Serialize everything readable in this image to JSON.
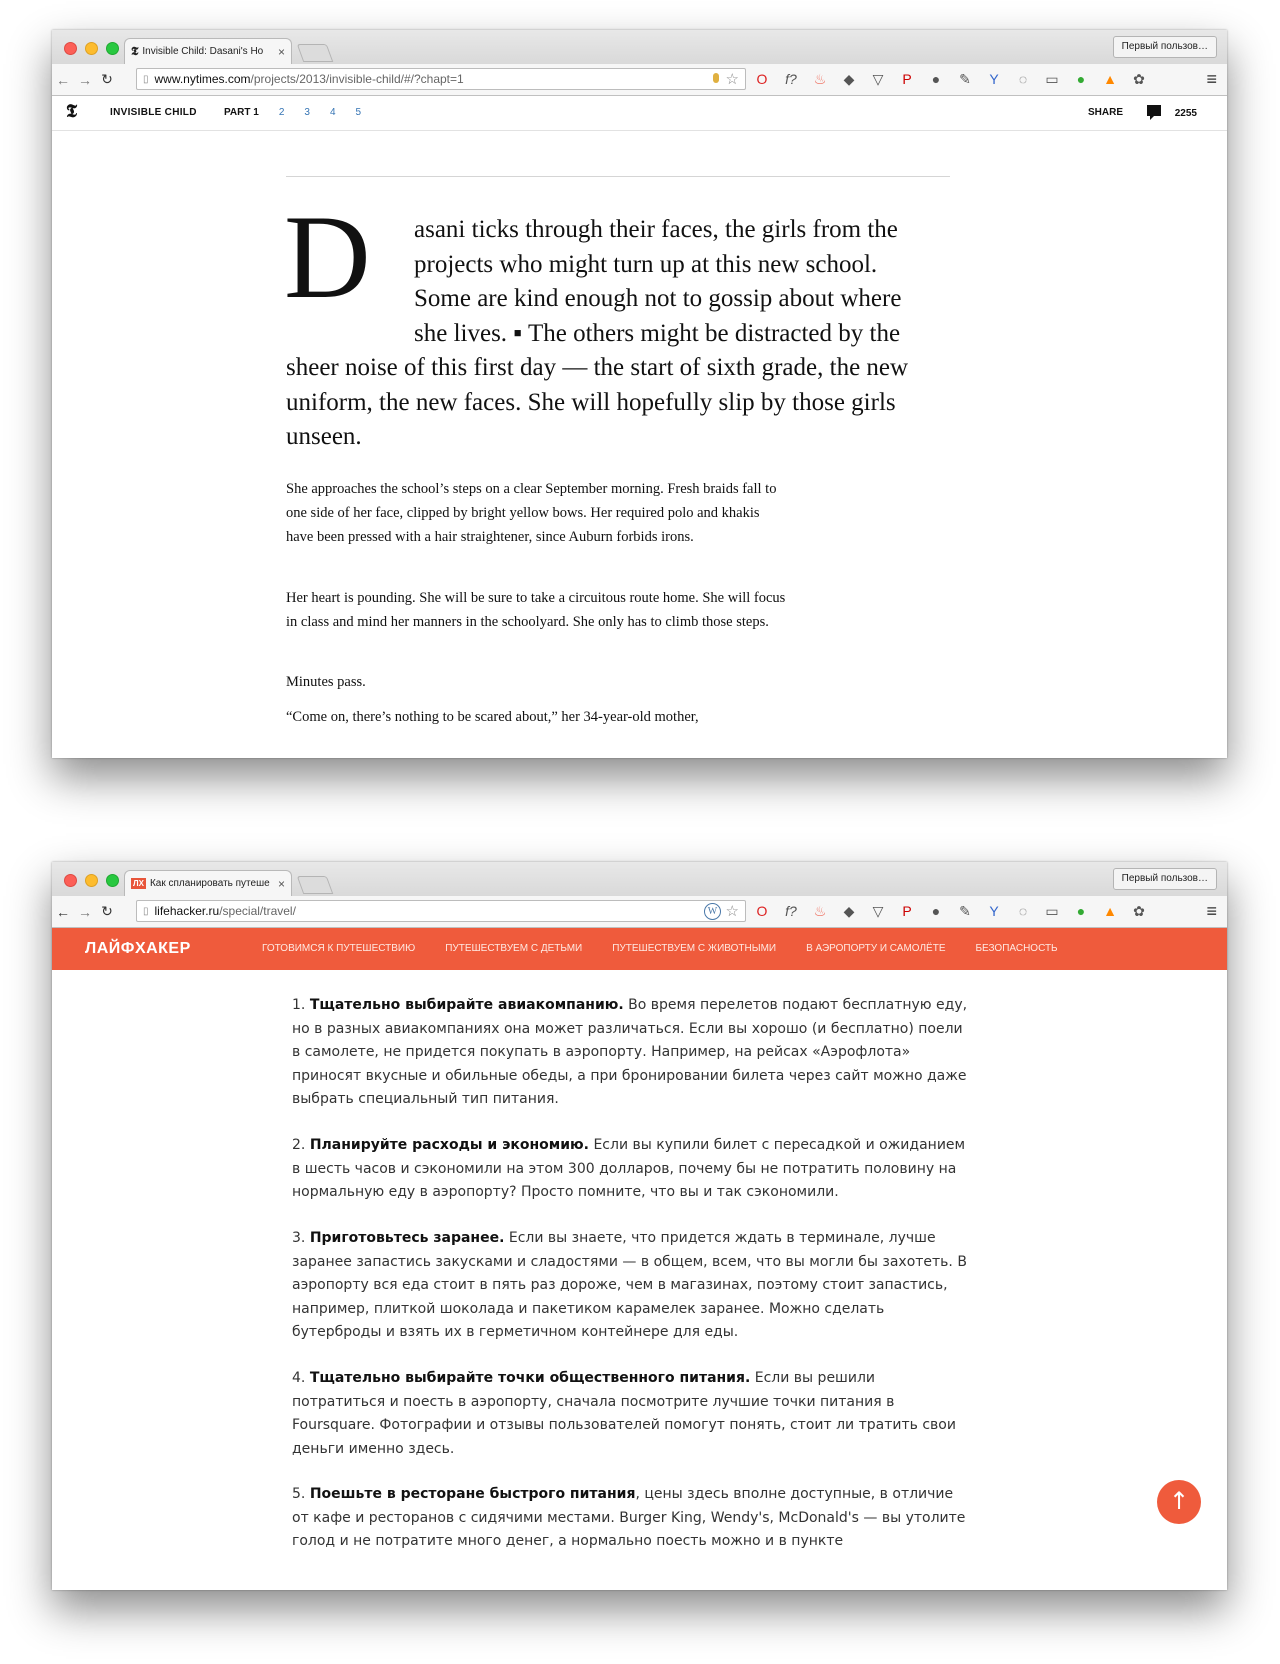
{
  "window1": {
    "tab": {
      "favicon": "𝕿",
      "title": "Invisible Child: Dasani's Ho",
      "close": "×"
    },
    "user_button": "Первый пользов…",
    "address": {
      "host": "www.nytimes.com",
      "path": "/projects/2013/invisible-child/#/?chapt=1"
    },
    "header": {
      "logo": "𝕿",
      "brand": "INVISIBLE CHILD",
      "part_label": "PART 1",
      "parts": [
        "2",
        "3",
        "4",
        "5"
      ],
      "share": "SHARE",
      "comments": "2255"
    },
    "article": {
      "dropcap": "D",
      "lede_lines": [
        "asani ticks through their faces, the girls from the",
        "projects who might turn up at this new school.",
        "Some are kind enough not to gossip about where",
        "she lives.  ▪  The others might be distracted by the"
      ],
      "lede_rest": "sheer noise of this first day — the start of sixth grade, the new uniform, the new faces. She will hopefully slip by those girls unseen.",
      "paragraphs": [
        "She approaches the school’s steps on a clear September morning. Fresh braids fall to one side of her face, clipped by bright yellow bows. Her required polo and khakis have been pressed with a hair straightener, since Auburn forbids irons.",
        "Her heart is pounding. She will be sure to take a circuitous route home. She will focus in class and mind her manners in the schoolyard. She only has to climb those steps.",
        "Minutes pass.",
        "“Come on, there’s nothing to be scared about,” her 34-year-old mother,"
      ]
    }
  },
  "window2": {
    "tab": {
      "favicon": "ЛХ",
      "title": "Как спланировать путеше",
      "close": "×"
    },
    "user_button": "Первый пользов…",
    "address": {
      "host": "lifehacker.ru",
      "path": "/special/travel/"
    },
    "header": {
      "logo": "ЛАЙФХАКЕР",
      "nav": [
        "ГОТОВИМСЯ К ПУТЕШЕСТВИЮ",
        "ПУТЕШЕСТВУЕМ С ДЕТЬМИ",
        "ПУТЕШЕСТВУЕМ С ЖИВОТНЫМИ",
        "В АЭРОПОРТУ И САМОЛЁТЕ",
        "БЕЗОПАСНОСТЬ"
      ]
    },
    "items": [
      {
        "num": "1. ",
        "bold": "Тщательно выбирайте авиакомпанию.",
        "text": " Во время перелетов подают бесплатную еду, но в разных авиакомпаниях она может различаться. Если вы хорошо (и бесплатно) поели в самолете, не придется покупать в аэропорту. Например, на рейсах «Аэрофлота» приносят вкусные и обильные обеды, а при бронировании билета через сайт можно даже выбрать специальный тип питания."
      },
      {
        "num": "2. ",
        "bold": "Планируйте расходы и экономию.",
        "text": " Если вы купили билет с пересадкой и ожиданием в шесть часов и сэкономили на этом 300 долларов, почему бы не потратить половину на нормальную еду в аэропорту? Просто помните, что вы и так сэкономили."
      },
      {
        "num": "3. ",
        "bold": "Приготовьтесь заранее.",
        "text": " Если вы знаете, что придется ждать в терминале, лучше заранее запастись закусками и сладостями — в общем, всем, что вы могли бы захотеть. В аэропорту вся еда стоит в пять раз дороже, чем в магазинах, поэтому стоит запастись, например, плиткой шоколада и пакетиком карамелек заранее. Можно сделать бутерброды и взять их в герметичном контейнере для еды."
      },
      {
        "num": "4. ",
        "bold": "Тщательно выбирайте точки общественного питания.",
        "text": " Если вы решили потратиться и поесть в аэропорту, сначала посмотрите лучшие точки питания в Foursquare. Фотографии и отзывы пользователей помогут понять, стоит ли тратить свои деньги именно здесь."
      },
      {
        "num": "5. ",
        "bold": "Поешьте в ресторане быстрого питания",
        "text": ", цены здесь вполне доступные, в отличие от кафе и ресторанов с сидячими местами. Burger King, Wendy's, McDonald's — вы утолите голод и не потратите много денег, а нормально поесть можно и в пункте"
      }
    ],
    "scroll_top": "↑"
  },
  "browser_icons": [
    "back-icon",
    "forward-icon",
    "reload-icon",
    "page-icon",
    "star-icon",
    "menu-icon"
  ]
}
